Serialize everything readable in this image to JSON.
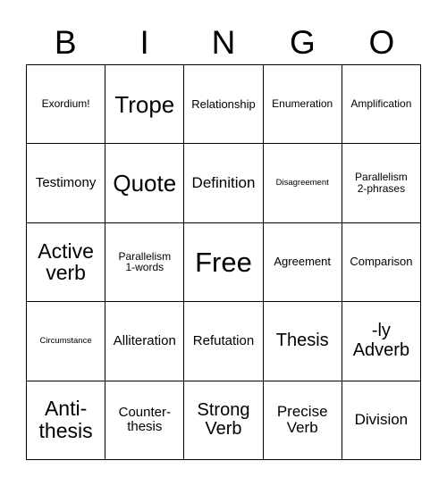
{
  "card": {
    "type": "bingo-card",
    "header_letters": [
      "B",
      "I",
      "N",
      "G",
      "O"
    ],
    "grid_size": "5x5",
    "free_space": "Free",
    "colors": {
      "background": "#ffffff",
      "text": "#000000",
      "grid_line": "#000000"
    },
    "rows": [
      [
        {
          "label": "Exordium!",
          "size": "sm"
        },
        {
          "label": "Trope",
          "size": "huge"
        },
        {
          "label": "Relationship",
          "size": "smm"
        },
        {
          "label": "Enumeration",
          "size": "sm"
        },
        {
          "label": "Amplification",
          "size": "sm"
        }
      ],
      [
        {
          "label": "Testimony",
          "size": "md"
        },
        {
          "label": "Quote",
          "size": "huge"
        },
        {
          "label": "Definition",
          "size": "lg"
        },
        {
          "label": "Disagreement",
          "size": "xs"
        },
        {
          "label": "Parallelism\n2-phrases",
          "size": "sm"
        }
      ],
      [
        {
          "label": "Active\nverb",
          "size": "xxl"
        },
        {
          "label": "Parallelism\n1-words",
          "size": "sm"
        },
        {
          "label": "Free",
          "size": "free"
        },
        {
          "label": "Agreement",
          "size": "smm"
        },
        {
          "label": "Comparison",
          "size": "smm"
        }
      ],
      [
        {
          "label": "Circumstance",
          "size": "xs"
        },
        {
          "label": "Alliteration",
          "size": "md"
        },
        {
          "label": "Refutation",
          "size": "md"
        },
        {
          "label": "Thesis",
          "size": "xl"
        },
        {
          "label": "-ly\nAdverb",
          "size": "xl"
        }
      ],
      [
        {
          "label": "Anti-\nthesis",
          "size": "xxl"
        },
        {
          "label": "Counter-\nthesis",
          "size": "md"
        },
        {
          "label": "Strong\nVerb",
          "size": "xl"
        },
        {
          "label": "Precise\nVerb",
          "size": "lg"
        },
        {
          "label": "Division",
          "size": "lg"
        }
      ]
    ]
  }
}
